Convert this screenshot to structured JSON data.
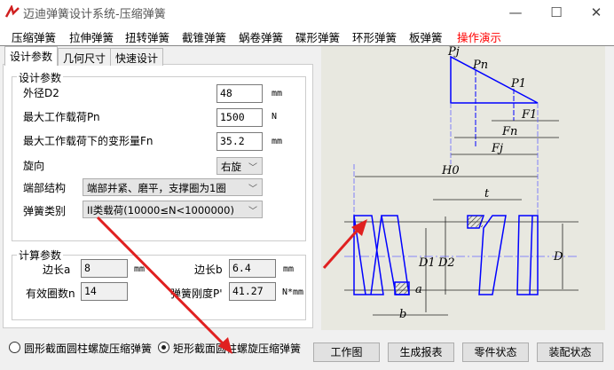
{
  "window": {
    "title": "迈迪弹簧设计系统-压缩弹簧",
    "minimize": "—",
    "maximize": "☐",
    "close": "✕"
  },
  "menu": [
    "压缩弹簧",
    "拉伸弹簧",
    "扭转弹簧",
    "截锥弹簧",
    "蜗卷弹簧",
    "碟形弹簧",
    "环形弹簧",
    "板弹簧",
    "操作演示"
  ],
  "tabs": [
    "设计参数",
    "几何尺寸",
    "快速设计"
  ],
  "design": {
    "group_label": "设计参数",
    "outer_diameter": {
      "label": "外径D2",
      "value": "48",
      "unit": "mm"
    },
    "max_load": {
      "label": "最大工作载荷Pn",
      "value": "1500",
      "unit": "N"
    },
    "deformation": {
      "label": "最大工作载荷下的变形量Fn",
      "value": "35.2",
      "unit": "mm"
    },
    "rotation": {
      "label": "旋向",
      "value": "右旋"
    },
    "end_structure": {
      "label": "端部结构",
      "value": "端部并紧、磨平，支撑圈为1圈"
    },
    "spring_class": {
      "label": "弹簧类别",
      "value": "II类载荷(10000≤N<1000000)"
    }
  },
  "calc": {
    "group_label": "计算参数",
    "side_a": {
      "label": "边长a",
      "value": "8",
      "unit": "mm"
    },
    "side_b": {
      "label": "边长b",
      "value": "6.4",
      "unit": "mm"
    },
    "coils": {
      "label": "有效圈数n",
      "value": "14"
    },
    "stiffness": {
      "label": "弹簧刚度P'",
      "value": "41.27",
      "unit": "N*mm"
    }
  },
  "radios": [
    {
      "label": "圆形截面圆柱螺旋压缩弹簧",
      "checked": false
    },
    {
      "label": "矩形截面圆柱螺旋压缩弹簧",
      "checked": true
    }
  ],
  "buttons": [
    "工作图",
    "生成报表",
    "零件状态",
    "装配状态"
  ],
  "diagram_labels": {
    "pj": "Pj",
    "pn": "Pn",
    "p1": "P1",
    "f1": "F1",
    "fn": "Fn",
    "fj": "Fj",
    "h0": "H0",
    "t": "t",
    "d1": "D1",
    "d2": "D2",
    "d": "D",
    "a": "a",
    "b": "b"
  },
  "colors": {
    "accent_menu": "#ff0000",
    "spring": "#0000ff",
    "arrow": "#e02020"
  }
}
